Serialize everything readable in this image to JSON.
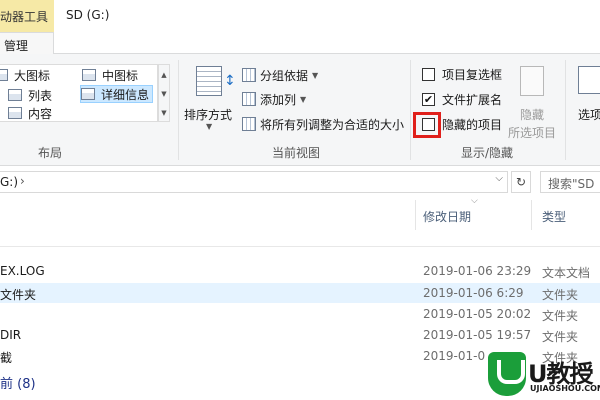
{
  "titlebar": {
    "tool_tab": "动器工具",
    "window_title": "SD (G:)"
  },
  "ribbon_tabs": {
    "manage": "管理"
  },
  "layout_group": {
    "label": "布局",
    "items": [
      {
        "label": "大图标",
        "icon": "large-icons-icon"
      },
      {
        "label": "中图标",
        "icon": "medium-icons-icon"
      },
      {
        "label": "列表",
        "icon": "list-icon"
      },
      {
        "label": "详细信息",
        "icon": "details-icon",
        "selected": true
      },
      {
        "label": "内容",
        "icon": "content-icon"
      }
    ]
  },
  "current_view_group": {
    "label": "当前视图",
    "sort_by": "排序方式",
    "group_by": "分组依据",
    "add_column": "添加列",
    "fit_columns": "将所有列调整为合适的大小"
  },
  "show_hide_group": {
    "label": "显示/隐藏",
    "checkboxes": [
      {
        "label": "项目复选框",
        "checked": false
      },
      {
        "label": "文件扩展名",
        "checked": true
      },
      {
        "label": "隐藏的项目",
        "checked": false
      }
    ],
    "hide_selected_line1": "隐藏",
    "hide_selected_line2": "所选项目",
    "highlight_color": "#e0201b"
  },
  "options": {
    "label": "选项"
  },
  "address_bar": {
    "path_fragment": "G:)",
    "search_placeholder": "搜索\"SD"
  },
  "columns": {
    "date_modified": "修改日期",
    "type": "类型"
  },
  "rows": [
    {
      "name": "EX.LOG",
      "date": "2019-01-06 23:29",
      "type": "文本文档",
      "selected": false
    },
    {
      "name": "文件夹",
      "date": "2019-01-06 6:29",
      "type": "文件夹",
      "selected": true
    },
    {
      "name": "",
      "date": "2019-01-05 20:02",
      "type": "文件夹",
      "selected": false
    },
    {
      "name": "DIR",
      "date": "2019-01-05 19:57",
      "type": "文件夹",
      "selected": false
    },
    {
      "name": "截",
      "date": "2019-01-0",
      "type": "文件夹",
      "selected": false
    }
  ],
  "group_header": "前 (8)",
  "watermark": {
    "main": "U教授",
    "sub": "UJIAOSHOU.COM"
  }
}
